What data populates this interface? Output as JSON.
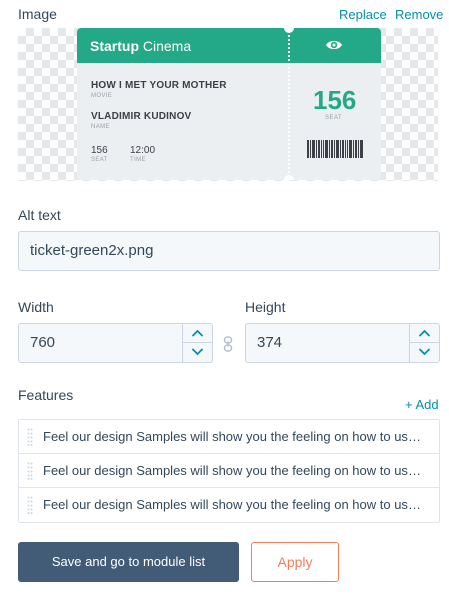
{
  "image_section": {
    "label": "Image",
    "replace_label": "Replace",
    "remove_label": "Remove"
  },
  "ticket": {
    "brand_bold": "Startup",
    "brand_rest": " Cinema",
    "movie_title": "HOW I MET YOUR MOTHER",
    "movie_caption": "MOVIE",
    "name_value": "VLADIMIR KUDINOV",
    "name_caption": "NAME",
    "seat_value": "156",
    "seat_caption": "SEAT",
    "time_value": "12:00",
    "time_caption": "TIME",
    "big_seat": "156",
    "big_seat_caption": "SEAT",
    "accent_color": "#23a987"
  },
  "alt_text": {
    "label": "Alt text",
    "value": "ticket-green2x.png"
  },
  "width": {
    "label": "Width",
    "value": "760"
  },
  "height": {
    "label": "Height",
    "value": "374"
  },
  "features": {
    "label": "Features",
    "add_label": "+ Add",
    "items": [
      {
        "text": "Feel our design Samples will show you the feeling on how to use this product"
      },
      {
        "text": "Feel our design Samples will show you the feeling on how to use this product"
      },
      {
        "text": "Feel our design Samples will show you the feeling on how to use this product"
      }
    ]
  },
  "actions": {
    "save_label": "Save and go to module list",
    "apply_label": "Apply"
  },
  "colors": {
    "primary_button": "#425b76",
    "secondary_button": "#ff7a59",
    "link": "#0091ae"
  }
}
